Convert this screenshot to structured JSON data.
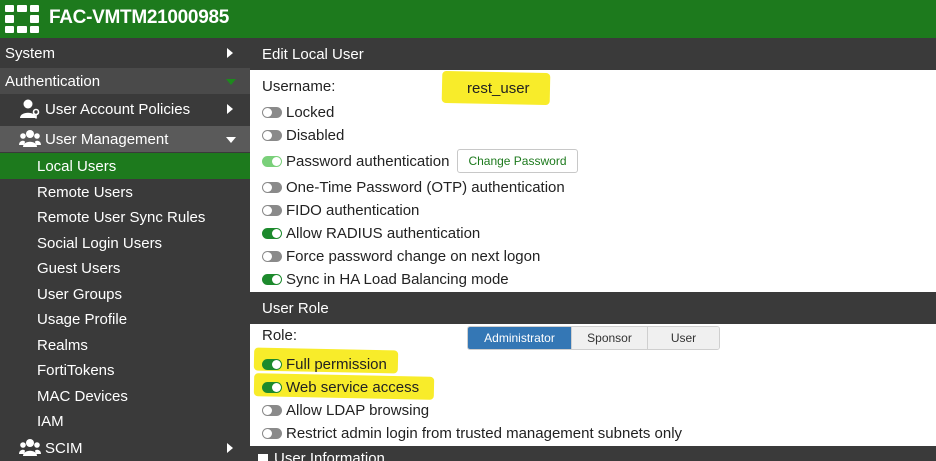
{
  "header": {
    "title": "FAC-VMTM21000985",
    "logo_icon": "fortinet-grid-logo"
  },
  "sidebar": {
    "system": "System",
    "authentication": "Authentication",
    "user_account_policies": "User Account Policies",
    "user_management": "User Management",
    "sub_items": [
      "Local Users",
      "Remote Users",
      "Remote User Sync Rules",
      "Social Login Users",
      "Guest Users",
      "User Groups",
      "Usage Profile",
      "Realms",
      "FortiTokens",
      "MAC Devices",
      "IAM"
    ],
    "active_item": "Local Users",
    "scim": "SCIM"
  },
  "edit_user": {
    "header": "Edit Local User",
    "username_label": "Username:",
    "username_value": "rest_user",
    "options": [
      {
        "label": "Locked",
        "state": "off"
      },
      {
        "label": "Disabled",
        "state": "off"
      },
      {
        "label": "Password authentication",
        "state": "on-light"
      },
      {
        "label": "One-Time Password (OTP) authentication",
        "state": "off"
      },
      {
        "label": "FIDO authentication",
        "state": "off"
      },
      {
        "label": "Allow RADIUS authentication",
        "state": "on"
      },
      {
        "label": "Force password change on next logon",
        "state": "off"
      },
      {
        "label": "Sync in HA Load Balancing mode",
        "state": "on"
      }
    ],
    "change_password_button": "Change Password"
  },
  "user_role": {
    "header": "User Role",
    "role_label": "Role:",
    "roles": [
      "Administrator",
      "Sponsor",
      "User"
    ],
    "selected_role": "Administrator",
    "options": [
      {
        "label": "Full permission",
        "state": "on"
      },
      {
        "label": "Web service access",
        "state": "on"
      },
      {
        "label": "Allow LDAP browsing",
        "state": "off"
      },
      {
        "label": "Restrict admin login from trusted management subnets only",
        "state": "off"
      }
    ]
  },
  "user_information": {
    "header": "User Information"
  },
  "colors": {
    "brand_green": "#1d7a1d",
    "sidebar_bg": "#3a3a3a",
    "toggle_on": "#1d8a2d",
    "selected_segment": "#3477b5",
    "highlight": "#f8ec2a"
  }
}
